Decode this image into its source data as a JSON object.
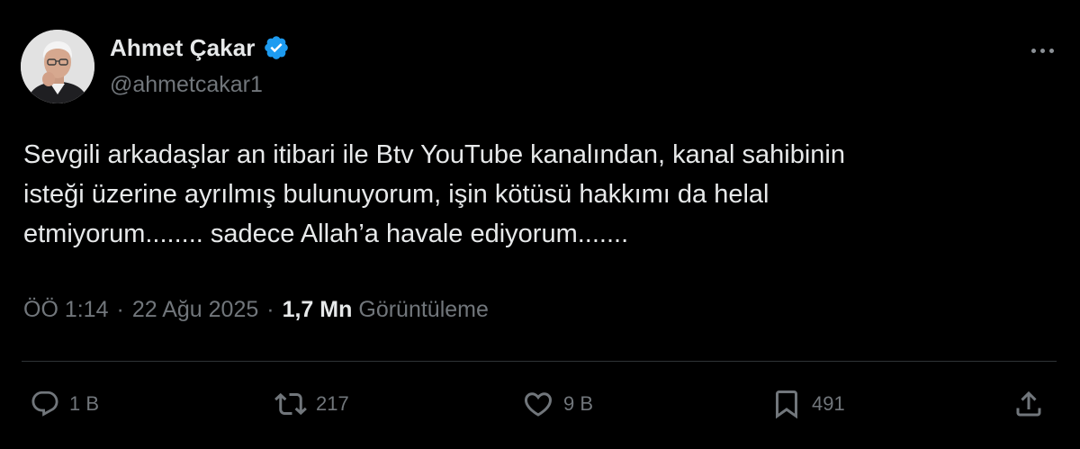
{
  "author": {
    "display_name": "Ahmet Çakar",
    "handle": "@ahmetcakar1",
    "verified": true
  },
  "tweet": {
    "text": "Sevgili arkadaşlar an itibari ile Btv YouTube kanalından, kanal sahibinin\nisteği üzerine ayrılmış bulunuyorum, işin kötüsü hakkımı da helal\netmiyorum........ sadece Allah’a havale ediyorum......."
  },
  "meta": {
    "time": "ÖÖ 1:14",
    "separator": "·",
    "date": "22 Ağu 2025",
    "views_count": "1,7 Mn",
    "views_label": "Görüntüleme"
  },
  "actions": {
    "replies": "1 B",
    "retweets": "217",
    "likes": "9 B",
    "bookmarks": "491"
  },
  "icons": {
    "verified": "verified-badge-icon",
    "more": "more-horizontal-icon",
    "reply": "reply-icon",
    "retweet": "retweet-icon",
    "like": "heart-icon",
    "bookmark": "bookmark-icon",
    "share": "share-icon"
  },
  "colors": {
    "background": "#000000",
    "text_primary": "#e7e9ea",
    "text_secondary": "#71767b",
    "verified_blue": "#1d9bf0",
    "divider": "#2f3336"
  }
}
